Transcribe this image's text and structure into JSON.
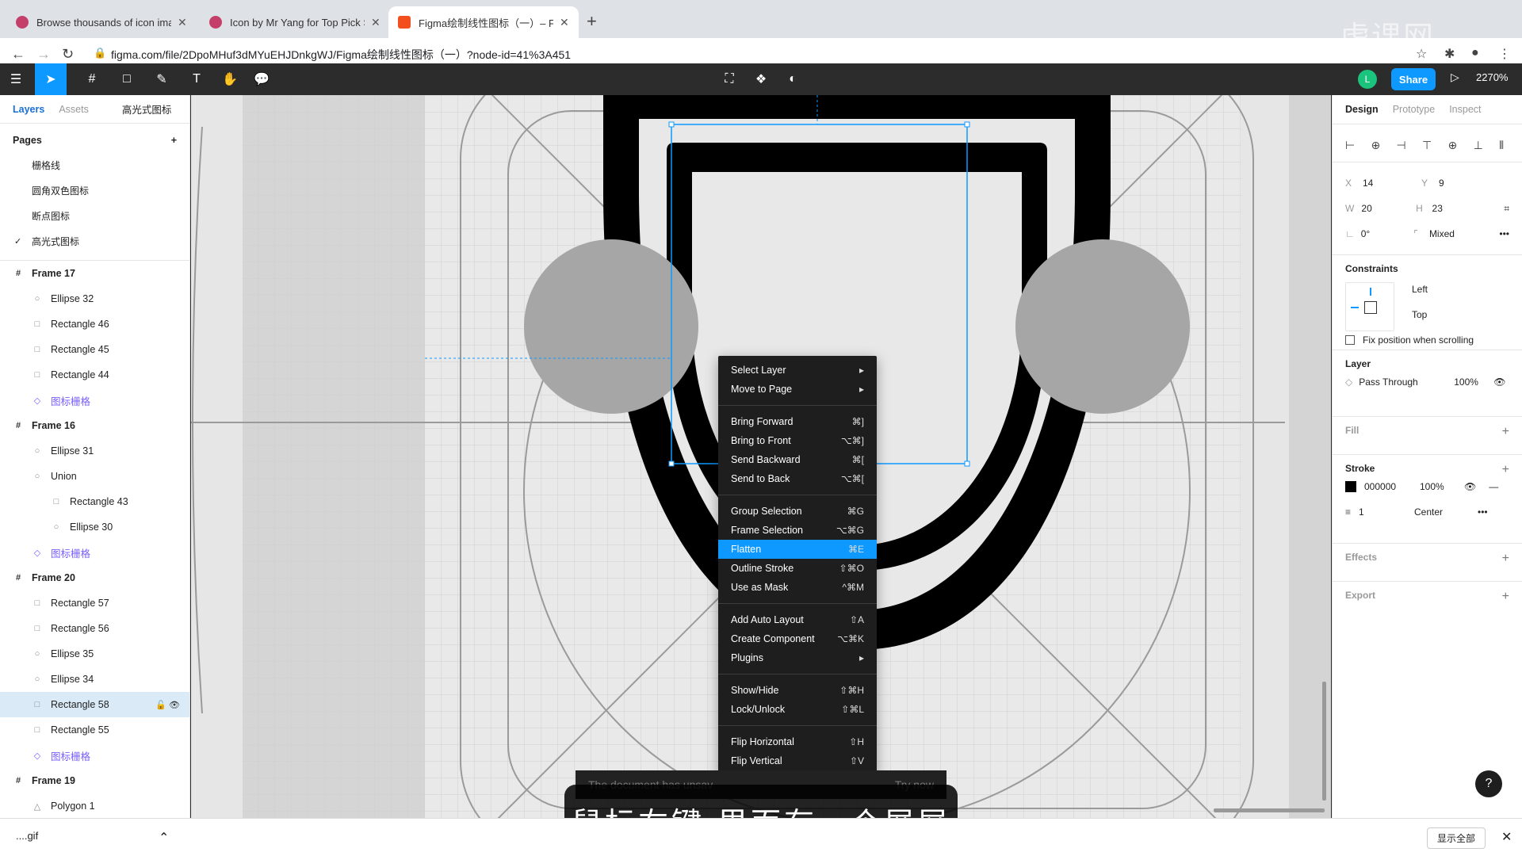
{
  "tabs": [
    {
      "label": "Browse thousands of icon imag",
      "fav_color": "#c4406a"
    },
    {
      "label": "Icon by Mr Yang for Top Pick S",
      "fav_color": "#c4406a"
    },
    {
      "label": "Figma绘制线性图标（一）– Fig",
      "fav_color": "#f24e1e"
    }
  ],
  "url": "figma.com/file/2DpoMHuf3dMYuEHJDnkgWJ/Figma绘制线性图标（一）?node-id=41%3A451",
  "toolbar": {
    "share_label": "Share",
    "zoom": "2270%",
    "avatar": "L"
  },
  "left_panel": {
    "tab_layers": "Layers",
    "tab_assets": "Assets",
    "current_page": "高光式图标",
    "pages_title": "Pages",
    "pages": [
      "栅格线",
      "圆角双色图标",
      "断点图标",
      "高光式图标"
    ],
    "layers": [
      {
        "name": "Frame 17",
        "type": "frame",
        "indent": 0
      },
      {
        "name": "Ellipse 32",
        "type": "ellipse",
        "indent": 1
      },
      {
        "name": "Rectangle 46",
        "type": "rect",
        "indent": 1
      },
      {
        "name": "Rectangle 45",
        "type": "rect",
        "indent": 1
      },
      {
        "name": "Rectangle 44",
        "type": "rect",
        "indent": 1
      },
      {
        "name": "图标栅格",
        "type": "comp",
        "indent": 1
      },
      {
        "name": "Frame 16",
        "type": "frame",
        "indent": 0
      },
      {
        "name": "Ellipse 31",
        "type": "ellipse",
        "indent": 1
      },
      {
        "name": "Union",
        "type": "ellipse",
        "indent": 1
      },
      {
        "name": "Rectangle 43",
        "type": "rect",
        "indent": 2
      },
      {
        "name": "Ellipse 30",
        "type": "ellipse",
        "indent": 2
      },
      {
        "name": "图标栅格",
        "type": "comp",
        "indent": 1
      },
      {
        "name": "Frame 20",
        "type": "frame",
        "indent": 0
      },
      {
        "name": "Rectangle 57",
        "type": "rect",
        "indent": 1
      },
      {
        "name": "Rectangle 56",
        "type": "rect",
        "indent": 1
      },
      {
        "name": "Ellipse 35",
        "type": "ellipse",
        "indent": 1
      },
      {
        "name": "Ellipse 34",
        "type": "ellipse",
        "indent": 1
      },
      {
        "name": "Rectangle 58",
        "type": "rect",
        "indent": 1,
        "selected": true
      },
      {
        "name": "Rectangle 55",
        "type": "rect",
        "indent": 1
      },
      {
        "name": "图标栅格",
        "type": "comp",
        "indent": 1
      },
      {
        "name": "Frame 19",
        "type": "frame",
        "indent": 0
      },
      {
        "name": "Polygon 1",
        "type": "polygon",
        "indent": 1
      }
    ]
  },
  "right_panel": {
    "tab_design": "Design",
    "tab_prototype": "Prototype",
    "tab_inspect": "Inspect",
    "x": "14",
    "y": "9",
    "w": "20",
    "h": "23",
    "rotation": "0°",
    "radius": "Mixed",
    "constraints_title": "Constraints",
    "constraint_h": "Left",
    "constraint_v": "Top",
    "fix_position": "Fix position when scrolling",
    "layer_title": "Layer",
    "blend": "Pass Through",
    "opacity": "100%",
    "fill_title": "Fill",
    "stroke_title": "Stroke",
    "stroke_color": "000000",
    "stroke_opacity": "100%",
    "stroke_width": "1",
    "stroke_align": "Center",
    "effects_title": "Effects",
    "export_title": "Export"
  },
  "context_menu": {
    "groups": [
      [
        {
          "label": "Select Layer",
          "shortcut": "▸"
        },
        {
          "label": "Move to Page",
          "shortcut": "▸"
        }
      ],
      [
        {
          "label": "Bring Forward",
          "shortcut": "⌘]"
        },
        {
          "label": "Bring to Front",
          "shortcut": "⌥⌘]"
        },
        {
          "label": "Send Backward",
          "shortcut": "⌘["
        },
        {
          "label": "Send to Back",
          "shortcut": "⌥⌘["
        }
      ],
      [
        {
          "label": "Group Selection",
          "shortcut": "⌘G"
        },
        {
          "label": "Frame Selection",
          "shortcut": "⌥⌘G"
        },
        {
          "label": "Flatten",
          "shortcut": "⌘E",
          "highlight": true
        },
        {
          "label": "Outline Stroke",
          "shortcut": "⇧⌘O"
        },
        {
          "label": "Use as Mask",
          "shortcut": "^⌘M"
        }
      ],
      [
        {
          "label": "Add Auto Layout",
          "shortcut": "⇧A"
        },
        {
          "label": "Create Component",
          "shortcut": "⌥⌘K"
        },
        {
          "label": "Plugins",
          "shortcut": "▸"
        }
      ],
      [
        {
          "label": "Show/Hide",
          "shortcut": "⇧⌘H"
        },
        {
          "label": "Lock/Unlock",
          "shortcut": "⇧⌘L"
        }
      ],
      [
        {
          "label": "Flip Horizontal",
          "shortcut": "⇧H"
        },
        {
          "label": "Flip Vertical",
          "shortcut": "⇧V"
        }
      ]
    ]
  },
  "toast": {
    "text": "The document has unsav",
    "action": "Try now"
  },
  "subtitle": "鼠标右键 里面有一个展屏",
  "bottom": {
    "download": "....gif",
    "show_all": "显示全部"
  },
  "watermark": "虎课网"
}
